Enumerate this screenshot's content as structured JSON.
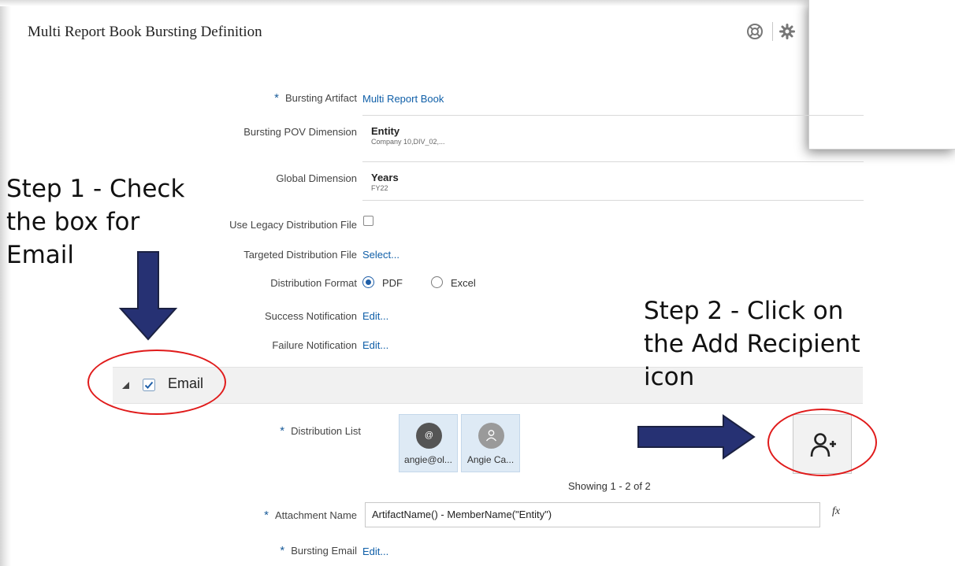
{
  "page": {
    "title": "Multi Report Book Bursting Definition"
  },
  "header_icons": [
    "help-lifebuoy-icon",
    "gear-icon"
  ],
  "form": {
    "bursting_artifact": {
      "label": "Bursting Artifact",
      "value": "Multi Report Book"
    },
    "bursting_pov_dimension": {
      "label": "Bursting POV Dimension",
      "value": "Entity",
      "members": "Company 10,DIV_02,..."
    },
    "global_dimension": {
      "label": "Global Dimension",
      "value": "Years",
      "members": "FY22"
    },
    "use_legacy_distribution_file": {
      "label": "Use Legacy Distribution File",
      "checked": false
    },
    "targeted_distribution_file": {
      "label": "Targeted Distribution File",
      "link": "Select..."
    },
    "distribution_format": {
      "label": "Distribution Format",
      "options": [
        "PDF",
        "Excel"
      ],
      "selected": "PDF"
    },
    "success_notification": {
      "label": "Success Notification",
      "link": "Edit..."
    },
    "failure_notification": {
      "label": "Failure Notification",
      "link": "Edit..."
    }
  },
  "email_section": {
    "label": "Email",
    "checked": true,
    "distribution_list": {
      "label": "Distribution List",
      "recipients": [
        {
          "name": "angie@ol...",
          "avatar": "@"
        },
        {
          "name": "Angie Ca...",
          "avatar": "person-icon"
        }
      ],
      "pagination": "Showing 1 - 2 of 2"
    },
    "add_recipient_icon": "add-user-icon",
    "attachment_name": {
      "label": "Attachment Name",
      "value": "ArtifactName() - MemberName(\"Entity\")",
      "formula_icon": "fx"
    },
    "bursting_email": {
      "label": "Bursting Email",
      "link": "Edit..."
    }
  },
  "annotations": {
    "step1": [
      "Step 1 - Check",
      "the box for",
      "Email"
    ],
    "step2": [
      "Step 2 - Click on",
      "the Add Recipient",
      "icon"
    ]
  },
  "colors": {
    "link": "#0f5fa8",
    "arrow_fill": "#263173",
    "arrow_stroke": "#1b2142",
    "highlight_ellipse": "#e01b1b",
    "recipient_tile": "#deeaf5"
  }
}
